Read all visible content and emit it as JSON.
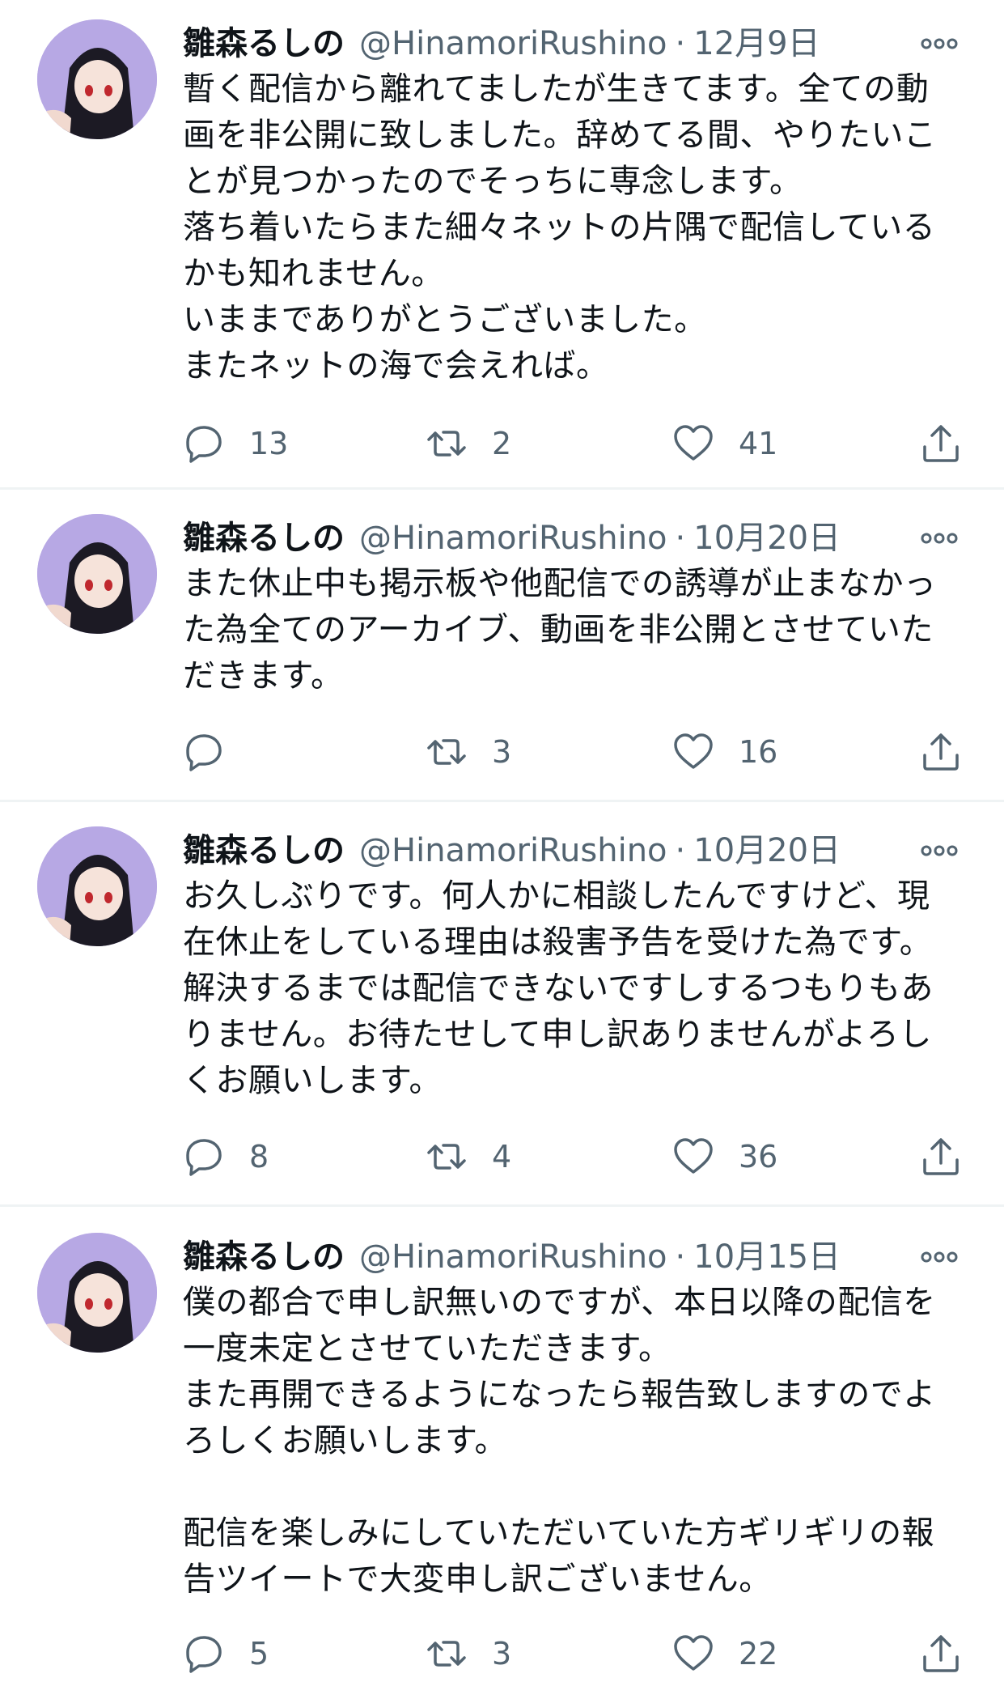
{
  "tweets": [
    {
      "name": "雛森るしの",
      "handle": "@HinamoriRushino",
      "separator": "·",
      "date": "12月9日",
      "text": "暫く配信から離れてましたが生きてます。全ての動\n画を非公開に致しました。辞めてる間、やりたいこ\nとが見つかったのでそっちに専念します。\n落ち着いたらまた細々ネットの片隅で配信している\nかも知れません。\nいままでありがとうございました。\nまたネットの海で会えれば。",
      "replies": "13",
      "retweets": "2",
      "likes": "41"
    },
    {
      "name": "雛森るしの",
      "handle": "@HinamoriRushino",
      "separator": "·",
      "date": "10月20日",
      "text": "また休止中も掲示板や他配信での誘導が止まなかっ\nた為全てのアーカイブ、動画を非公開とさせていた\nだきます。",
      "replies": "",
      "retweets": "3",
      "likes": "16"
    },
    {
      "name": "雛森るしの",
      "handle": "@HinamoriRushino",
      "separator": "·",
      "date": "10月20日",
      "text": "お久しぶりです。何人かに相談したんですけど、現\n在休止をしている理由は殺害予告を受けた為です。\n解決するまでは配信できないですしするつもりもあ\nりません。お待たせして申し訳ありませんがよろし\nくお願いします。",
      "replies": "8",
      "retweets": "4",
      "likes": "36"
    },
    {
      "name": "雛森るしの",
      "handle": "@HinamoriRushino",
      "separator": "·",
      "date": "10月15日",
      "text": "僕の都合で申し訳無いのですが、本日以降の配信を\n一度未定とさせていただきます。\nまた再開できるようになったら報告致しますのでよ\nろしくお願いします。\n\n配信を楽しみにしていただいていた方ギリギリの報\n告ツイートで大変申し訳ございません。",
      "replies": "5",
      "retweets": "3",
      "likes": "22"
    }
  ],
  "icons": {
    "reply": "reply-icon",
    "retweet": "retweet-icon",
    "like": "like-icon",
    "share": "share-icon",
    "more": "more-icon"
  },
  "colors": {
    "text": "#0f1419",
    "secondary": "#536471",
    "divider": "#eff3f4",
    "avatar_bg": "#b9a9e6"
  }
}
